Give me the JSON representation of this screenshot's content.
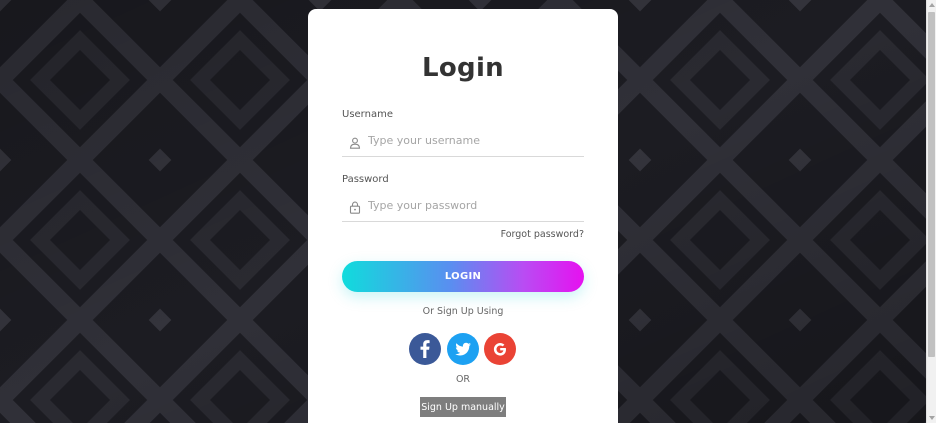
{
  "login": {
    "title": "Login",
    "username": {
      "label": "Username",
      "placeholder": "Type your username",
      "value": "",
      "icon": "user-icon"
    },
    "password": {
      "label": "Password",
      "placeholder": "Type your password",
      "value": "",
      "icon": "lock-icon"
    },
    "forgot_password": "Forgot password?",
    "login_button": "LOGIN",
    "sign_up_using": "Or Sign Up Using",
    "social": [
      {
        "name": "facebook",
        "glyph": "f",
        "color": "#3b5998",
        "icon": "facebook-icon"
      },
      {
        "name": "twitter",
        "glyph": "",
        "color": "#1da1f2",
        "icon": "twitter-icon"
      },
      {
        "name": "google",
        "glyph": "G",
        "color": "#ea4335",
        "icon": "google-icon"
      }
    ],
    "or": "OR",
    "sign_up_manually": "Sign Up manually"
  },
  "colors": {
    "gradient_start": "#10dcdc",
    "gradient_end": "#e611f0",
    "background": "#1c1c22",
    "card": "#ffffff"
  }
}
